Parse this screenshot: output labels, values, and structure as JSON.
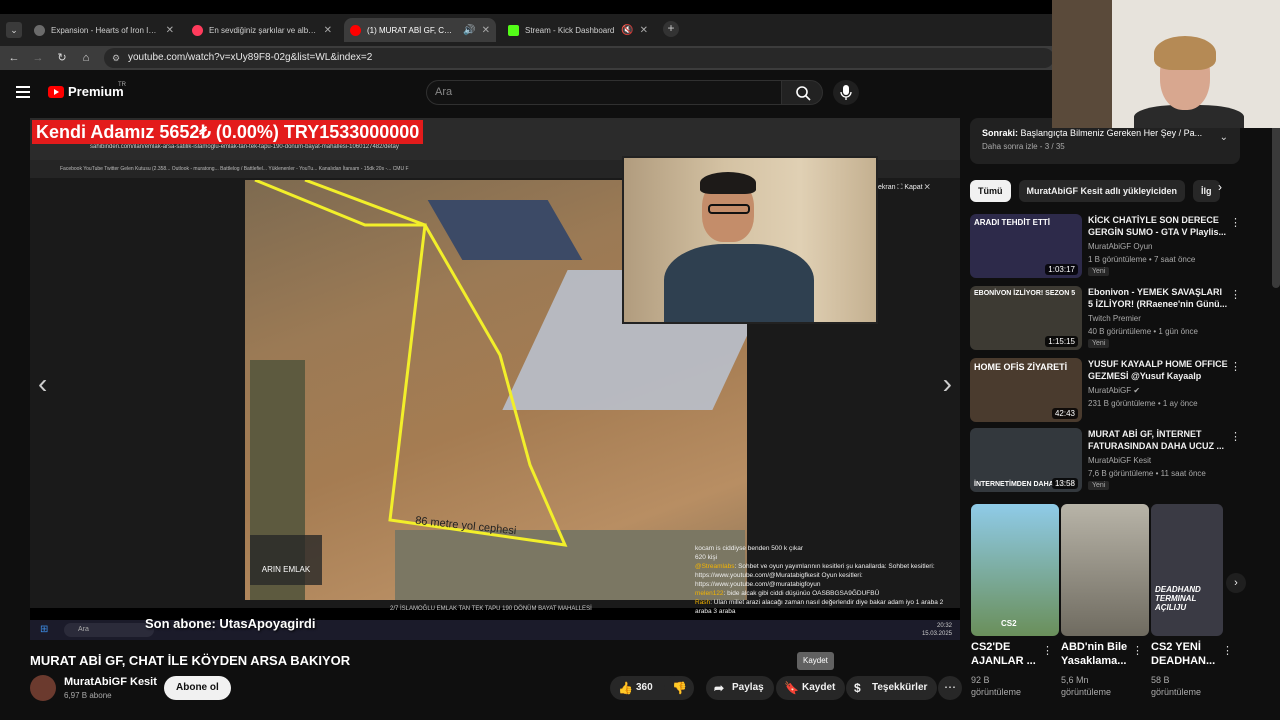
{
  "tabs": [
    {
      "title": "Expansion - Hearts of Iron IV: N",
      "color": "#6b6b6b",
      "active": false
    },
    {
      "title": "En sevdiğiniz şarkılar ve albümle",
      "color": "#ff3b5c",
      "active": false
    },
    {
      "title": "(1) MURAT ABİ GF, CHAT İLE",
      "color": "#ff0000",
      "active": true
    },
    {
      "title": "Stream - Kick Dashboard",
      "color": "#53fc18",
      "active": false
    }
  ],
  "address": {
    "url": "youtube.com/watch?v=xUy89F8-02g&list=WL&index=2"
  },
  "header": {
    "brand": "Premium",
    "region": "TR",
    "search_placeholder": "Ara"
  },
  "video": {
    "ticker": "Kendi Adamız   5652₺ (0.00%) TRY1533000000",
    "inner_url": "sahibinden.com/ilan/emlak-arsa-satilik-islamoglu-emlak-tan-tek-tapu-190-donum-bayat-mahallesi-1060127482/detay",
    "inner_bookmarks": "Facebook   YouTube   Twitter   Gelen Kutusu (2.358...   Outlook - muratong...   Battlelog / Battlefiel...   Yüklenenler - YouTu...   Kanalıdan   İtanıam - 15dk 20s -...   CMU F",
    "road_text": "86 metre yol cephesi",
    "logo_text": "ARIN EMLAK",
    "screen_close": "ekran",
    "close_label": "Kapat",
    "page_info": "2/7     İSLAMOĞLU EMLAK TAN TEK TAPU 190 DÖNÜM BAYAT MAHALLESİ",
    "last_sub": "Son abone: UtasApoyagirdi",
    "chat": [
      {
        "user": "",
        "text": "kocam is ciddiyse benden 500 k çıkar"
      },
      {
        "user": "",
        "text": "620 kişi"
      },
      {
        "user": "@Streamlabs",
        "text": ": Sohbet ve oyun yayımlarının kesitleri şu kanallarda: Sohbet kesitleri: https://www.youtube.com/@Muratabigfkesit Oyun kesitleri: https://www.youtube.com/@muratabigfoyun"
      },
      {
        "user": "melen122",
        "text": ": bide alcak gibi ciddi düşünüo OASBBGSA9ĞDUFBÜ"
      },
      {
        "user": "Rash",
        "text": ": Ulan millet arazi alacağı zaman nasıl değerlendir diye bakar adam iyo 1 araba 2 araba 3 araba"
      }
    ],
    "taskbar_search": "Ara",
    "clock": "20:32",
    "date": "15.03.2025"
  },
  "video_title": "MURAT ABİ GF, CHAT İLE KÖYDEN ARSA BAKIYOR",
  "channel": {
    "name": "MuratAbiGF Kesit",
    "subs": "6,97 B abone",
    "subscribe": "Abone ol"
  },
  "actions": {
    "likes": "360",
    "share": "Paylaş",
    "save": "Kaydet",
    "thanks": "Teşekkürler",
    "tooltip": "Kaydet"
  },
  "next": {
    "label": "Sonraki:",
    "title": "Başlangıçta Bilmeniz Gereken Her Şey / Pa...",
    "sub": "Daha sonra izle - 3 / 35"
  },
  "chips": [
    "Tümü",
    "MuratAbiGF Kesit adlı yükleyiciden",
    "İlg"
  ],
  "recommendations": [
    {
      "title": "KİCK CHATİYLE SON DERECE GERGİN SUMO - GTA V Playlis...",
      "channel": "MuratAbiGF Oyun",
      "meta": "1 B görüntüleme • 7 saat önce",
      "badge": "Yeni",
      "duration": "1:03:17",
      "thumb_text": "ARADI TEHDİT ETTİ",
      "color": "#2d2a4a"
    },
    {
      "title": "Ebonivon - YEMEK SAVAŞLARI 5 İZLİYOR! (RRaenee'nin Günü...",
      "channel": "Twitch Premier",
      "meta": "40 B görüntüleme • 1 gün önce",
      "badge": "Yeni",
      "duration": "1:15:15",
      "thumb_text": "EBONİVON İZLİYOR! SEZON 5",
      "color": "#3d3a33"
    },
    {
      "title": "YUSUF KAYAALP HOME OFFICE GEZMESİ @Yusuf Kayaalp",
      "channel": "MuratAbiGF",
      "meta": "231 B görüntüleme • 1 ay önce",
      "badge": "",
      "duration": "42:43",
      "thumb_text": "HOME OFİS ZİYARETİ",
      "color": "#4a3b2e"
    },
    {
      "title": "MURAT ABİ GF, İNTERNET FATURASINDAN DAHA UCUZ ...",
      "channel": "MuratAbiGF Kesit",
      "meta": "7,6 B görüntüleme • 11 saat önce",
      "badge": "Yeni",
      "duration": "13:58",
      "thumb_text": "İNTERNETİMDEN DAHA UCUZ",
      "color": "#33383d"
    }
  ],
  "shorts": [
    {
      "title": "CS2'DE AJANLAR ...",
      "meta1": "92 B",
      "meta2": "görüntüleme",
      "color": "#5aa9d6"
    },
    {
      "title": "ABD'nin Bile Yasaklama...",
      "meta1": "5,6 Mn",
      "meta2": "görüntüleme",
      "color": "#7a7a70"
    },
    {
      "title": "CS2 YENİ DEADHAN...",
      "meta1": "58 B",
      "meta2": "görüntüleme",
      "color": "#3a3a44"
    }
  ],
  "shorts_labels": {
    "s0": "CS2",
    "s2": "DEADHAND TERMINAL AÇILIJU"
  }
}
